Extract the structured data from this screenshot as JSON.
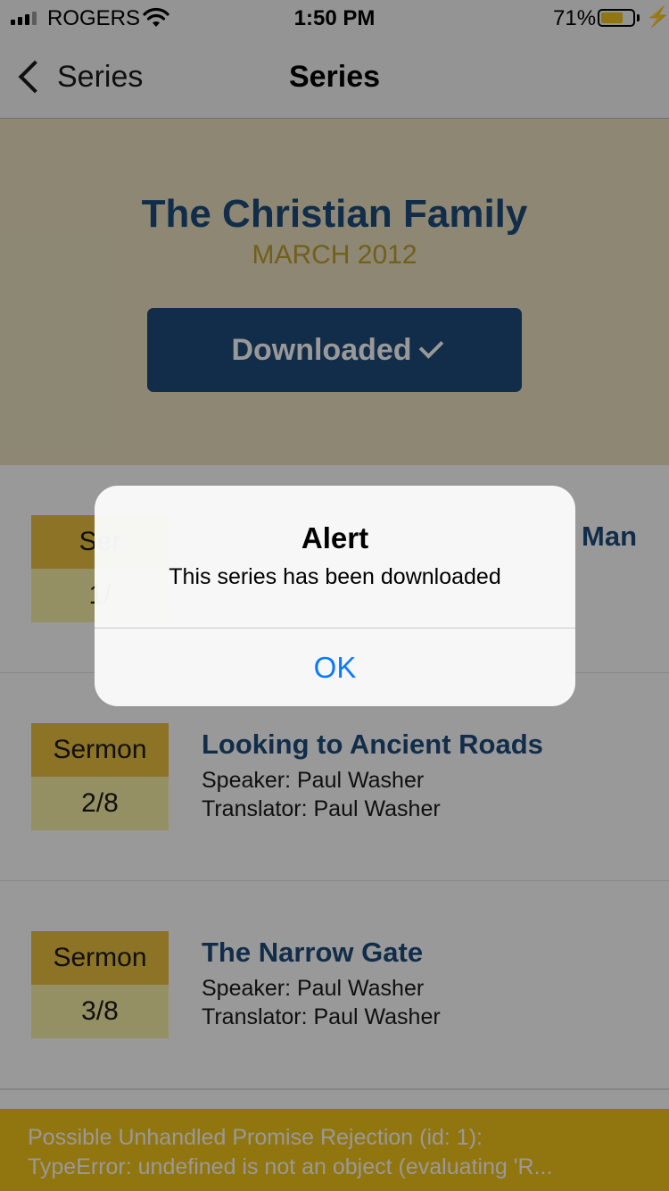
{
  "status_bar": {
    "carrier": "ROGERS",
    "time": "1:50 PM",
    "battery_percent": "71%",
    "battery_level": 0.71,
    "icons": [
      "signal-icon",
      "wifi-icon",
      "battery-icon",
      "charging-bolt-icon"
    ]
  },
  "nav": {
    "back_label": "Series",
    "title": "Series"
  },
  "series": {
    "title": "The Christian Family",
    "date": "MARCH 2012",
    "download_label": "Downloaded"
  },
  "sermons": [
    {
      "badge_label": "Ser",
      "badge_count": "1/",
      "title_visible": "Man"
    },
    {
      "badge_label": "Sermon",
      "badge_count": "2/8",
      "title": "Looking to Ancient Roads",
      "speaker": "Speaker: Paul Washer",
      "translator": "Translator: Paul Washer"
    },
    {
      "badge_label": "Sermon",
      "badge_count": "3/8",
      "title": "The Narrow Gate",
      "speaker": "Speaker: Paul Washer",
      "translator": "Translator: Paul Washer"
    }
  ],
  "toast": {
    "line1": "Possible Unhandled Promise Rejection (id: 1):",
    "line2": "TypeError: undefined is not an object (evaluating 'R..."
  },
  "alert": {
    "title": "Alert",
    "message": "This series has been downloaded",
    "ok_label": "OK"
  },
  "colors": {
    "brand_blue": "#1f4c7a",
    "gold": "#e9c040",
    "ios_link": "#0a7aff",
    "warning_yellow": "#f2c418"
  }
}
